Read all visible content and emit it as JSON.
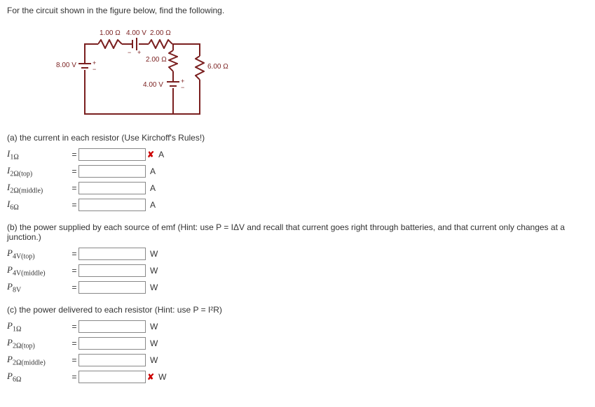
{
  "stem": "For the circuit shown in the figure below, find the following.",
  "circuit": {
    "r1_top": "1.00 Ω",
    "v4_top": "4.00 V",
    "r2_top": "2.00 Ω",
    "r2_mid": "2.00 Ω",
    "r6": "6.00 Ω",
    "v4_mid": "4.00 V",
    "v8": "8.00 V"
  },
  "partA": {
    "prompt": "(a) the current in each resistor (Use Kirchoff's Rules!)",
    "rows": [
      {
        "label_html": "I<sub>1Ω</sub>",
        "unit": "A",
        "wrong": true
      },
      {
        "label_html": "I<sub>2Ω(top)</sub>",
        "unit": "A",
        "wrong": false
      },
      {
        "label_html": "I<sub>2Ω(middle)</sub>",
        "unit": "A",
        "wrong": false
      },
      {
        "label_html": "I<sub>6Ω</sub>",
        "unit": "A",
        "wrong": false
      }
    ]
  },
  "partB": {
    "prompt": "(b) the power supplied by each source of emf (Hint: use P = IΔV and recall that current goes right through batteries, and that current only changes at a junction.)",
    "rows": [
      {
        "label_html": "P<sub>4V(top)</sub>",
        "unit": "W"
      },
      {
        "label_html": "P<sub>4V(middle)</sub>",
        "unit": "W"
      },
      {
        "label_html": "P<sub>8V</sub>",
        "unit": "W"
      }
    ]
  },
  "partC": {
    "prompt": "(c) the power delivered to each resistor (Hint: use P = I²R)",
    "rows": [
      {
        "label_html": "P<sub>1Ω</sub>",
        "unit": "W",
        "wrong": false
      },
      {
        "label_html": "P<sub>2Ω(top)</sub>",
        "unit": "W",
        "wrong": false
      },
      {
        "label_html": "P<sub>2Ω(middle)</sub>",
        "unit": "W",
        "wrong": false
      },
      {
        "label_html": "P<sub>6Ω</sub>",
        "unit": "W",
        "wrong": true
      }
    ]
  }
}
